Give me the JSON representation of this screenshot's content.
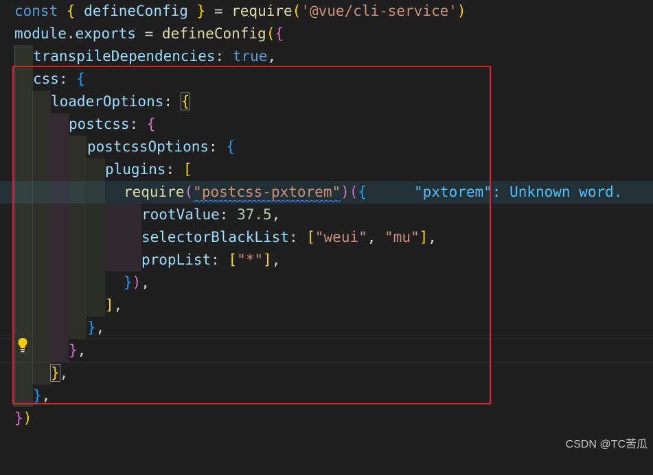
{
  "code": {
    "line1": {
      "kw_const": "const",
      "brace_open": "{",
      "name": " defineConfig ",
      "brace_close": "}",
      "eq": " = ",
      "require": "require",
      "paren_open": "(",
      "module_str": "'@vue/cli-service'",
      "paren_close": ")"
    },
    "line2": {
      "module": "module",
      "dot": ".",
      "exports": "exports",
      "eq": " = ",
      "fn": "defineConfig",
      "paren": "(",
      "brace": "{"
    },
    "line3": {
      "key": "transpileDependencies",
      "colon": ": ",
      "value": "true",
      "comma": ","
    },
    "line4": {
      "key": "css",
      "colon": ": ",
      "brace": "{"
    },
    "line5": {
      "key": "loaderOptions",
      "colon": ": ",
      "brace": "{"
    },
    "line6": {
      "key": "postcss",
      "colon": ": ",
      "brace": "{"
    },
    "line7": {
      "key": "postcssOptions",
      "colon": ": ",
      "brace": "{"
    },
    "line8": {
      "key": "plugins",
      "colon": ": ",
      "bracket": "["
    },
    "line9": {
      "fn": "require",
      "paren": "(",
      "str": "\"postcss-pxtorem\"",
      "paren_close": ")",
      "paren2": "(",
      "brace": "{"
    },
    "line10": {
      "key": "rootValue",
      "colon": ": ",
      "value": "37.5",
      "comma": ","
    },
    "line11": {
      "key": "selectorBlackList",
      "colon": ": ",
      "bracket_open": "[",
      "v1": "\"weui\"",
      "sep": ", ",
      "v2": "\"mu\"",
      "bracket_close": "]",
      "comma": ","
    },
    "line12": {
      "key": "propList",
      "colon": ": ",
      "bracket_open": "[",
      "v1": "\"*\"",
      "bracket_close": "]",
      "comma": ","
    },
    "line13": {
      "brace": "}",
      "paren": ")",
      "comma": ","
    },
    "line14": {
      "bracket": "]",
      "comma": ","
    },
    "line15": {
      "brace": "}",
      "comma": ","
    },
    "line16": {
      "brace": "}",
      "comma": ","
    },
    "line17": {
      "brace": "}",
      "comma": ","
    },
    "line18": {
      "brace": "}",
      "comma": ","
    },
    "line19": {
      "brace": "}",
      "paren": ")"
    }
  },
  "diagnostic": {
    "message": "\"pxtorem\": Unknown word."
  },
  "watermark": "CSDN @TC苦瓜",
  "colors": {
    "annotation_box": "#e2222c",
    "background": "#1f1f1f"
  },
  "icons": {
    "lightbulb": "lightbulb-icon",
    "hint_dots": "hint-dots-icon"
  }
}
